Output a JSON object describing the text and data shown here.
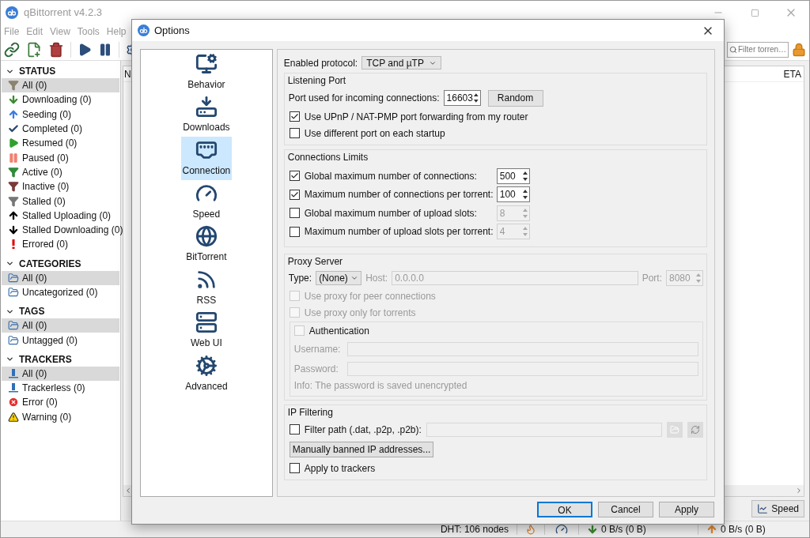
{
  "window": {
    "title": "qBittorrent v4.2.3",
    "menu": [
      "File",
      "Edit",
      "View",
      "Tools",
      "Help"
    ],
    "search": {
      "placeholder": "Filter torren…"
    },
    "sidebar": [
      {
        "title": "STATUS",
        "expanded": true,
        "items": [
          {
            "label": "All (0)",
            "selected": true
          },
          {
            "label": "Downloading (0)",
            "selected": false
          },
          {
            "label": "Seeding (0)",
            "selected": false
          },
          {
            "label": "Completed (0)",
            "selected": false
          },
          {
            "label": "Resumed (0)",
            "selected": false
          },
          {
            "label": "Paused (0)",
            "selected": false
          },
          {
            "label": "Active (0)",
            "selected": false
          },
          {
            "label": "Inactive (0)",
            "selected": false
          },
          {
            "label": "Stalled (0)",
            "selected": false
          },
          {
            "label": "Stalled Uploading (0)",
            "selected": false
          },
          {
            "label": "Stalled Downloading (0)",
            "selected": false
          },
          {
            "label": "Errored (0)",
            "selected": false
          }
        ]
      },
      {
        "title": "CATEGORIES",
        "expanded": true,
        "items": [
          {
            "label": "All (0)",
            "selected": true
          },
          {
            "label": "Uncategorized (0)",
            "selected": false
          }
        ]
      },
      {
        "title": "TAGS",
        "expanded": true,
        "items": [
          {
            "label": "All (0)",
            "selected": true
          },
          {
            "label": "Untagged (0)",
            "selected": false
          }
        ]
      },
      {
        "title": "TRACKERS",
        "expanded": true,
        "items": [
          {
            "label": "All (0)",
            "selected": true
          },
          {
            "label": "Trackerless (0)",
            "selected": false
          },
          {
            "label": "Error (0)",
            "selected": false
          },
          {
            "label": "Warning (0)",
            "selected": false
          }
        ]
      }
    ],
    "table": {
      "columns": [
        "N",
        "ETA"
      ]
    },
    "speed_button": "Speed",
    "status_bar": {
      "dht": "DHT: 106 nodes",
      "download": "0 B/s (0 B)",
      "upload": "0 B/s (0 B)"
    }
  },
  "dialog": {
    "title": "Options",
    "pages": [
      {
        "label": "Behavior",
        "selected": false
      },
      {
        "label": "Downloads",
        "selected": false
      },
      {
        "label": "Connection",
        "selected": true
      },
      {
        "label": "Speed",
        "selected": false
      },
      {
        "label": "BitTorrent",
        "selected": false
      },
      {
        "label": "RSS",
        "selected": false
      },
      {
        "label": "Web UI",
        "selected": false
      },
      {
        "label": "Advanced",
        "selected": false
      }
    ],
    "protocol": {
      "label": "Enabled protocol:",
      "value": "TCP and µTP"
    },
    "listening_port": {
      "title": "Listening Port",
      "port_label": "Port used for incoming connections:",
      "port_value": "16603",
      "random_button": "Random",
      "options": [
        {
          "label": "Use UPnP / NAT-PMP port forwarding from my router",
          "checked": true
        },
        {
          "label": "Use different port on each startup",
          "checked": false
        }
      ]
    },
    "connection_limits": {
      "title": "Connections Limits",
      "rows": [
        {
          "label": "Global maximum number of connections:",
          "checked": true,
          "value": "500"
        },
        {
          "label": "Maximum number of connections per torrent:",
          "checked": true,
          "value": "100"
        },
        {
          "label": "Global maximum number of upload slots:",
          "checked": false,
          "value": "8"
        },
        {
          "label": "Maximum number of upload slots per torrent:",
          "checked": false,
          "value": "4"
        }
      ]
    },
    "proxy": {
      "title": "Proxy Server",
      "disabled": true,
      "type_label": "Type:",
      "type_value": "(None)",
      "host_label": "Host:",
      "host_value": "0.0.0.0",
      "port_label": "Port:",
      "port_value": "8080",
      "options": [
        {
          "label": "Use proxy for peer connections",
          "checked": false
        },
        {
          "label": "Use proxy only for torrents",
          "checked": false
        }
      ],
      "auth": {
        "label": "Authentication",
        "checked": false,
        "username_label": "Username:",
        "password_label": "Password:",
        "info": "Info: The password is saved unencrypted"
      }
    },
    "ip_filtering": {
      "title": "IP Filtering",
      "filter_label": "Filter path (.dat, .p2p, .p2b):",
      "filter_checked": false,
      "banned_button": "Manually banned IP addresses...",
      "trackers_label": "Apply to trackers",
      "trackers_checked": false
    },
    "buttons": [
      {
        "label": "OK",
        "default": true
      },
      {
        "label": "Cancel",
        "default": false
      },
      {
        "label": "Apply",
        "default": false
      }
    ]
  }
}
